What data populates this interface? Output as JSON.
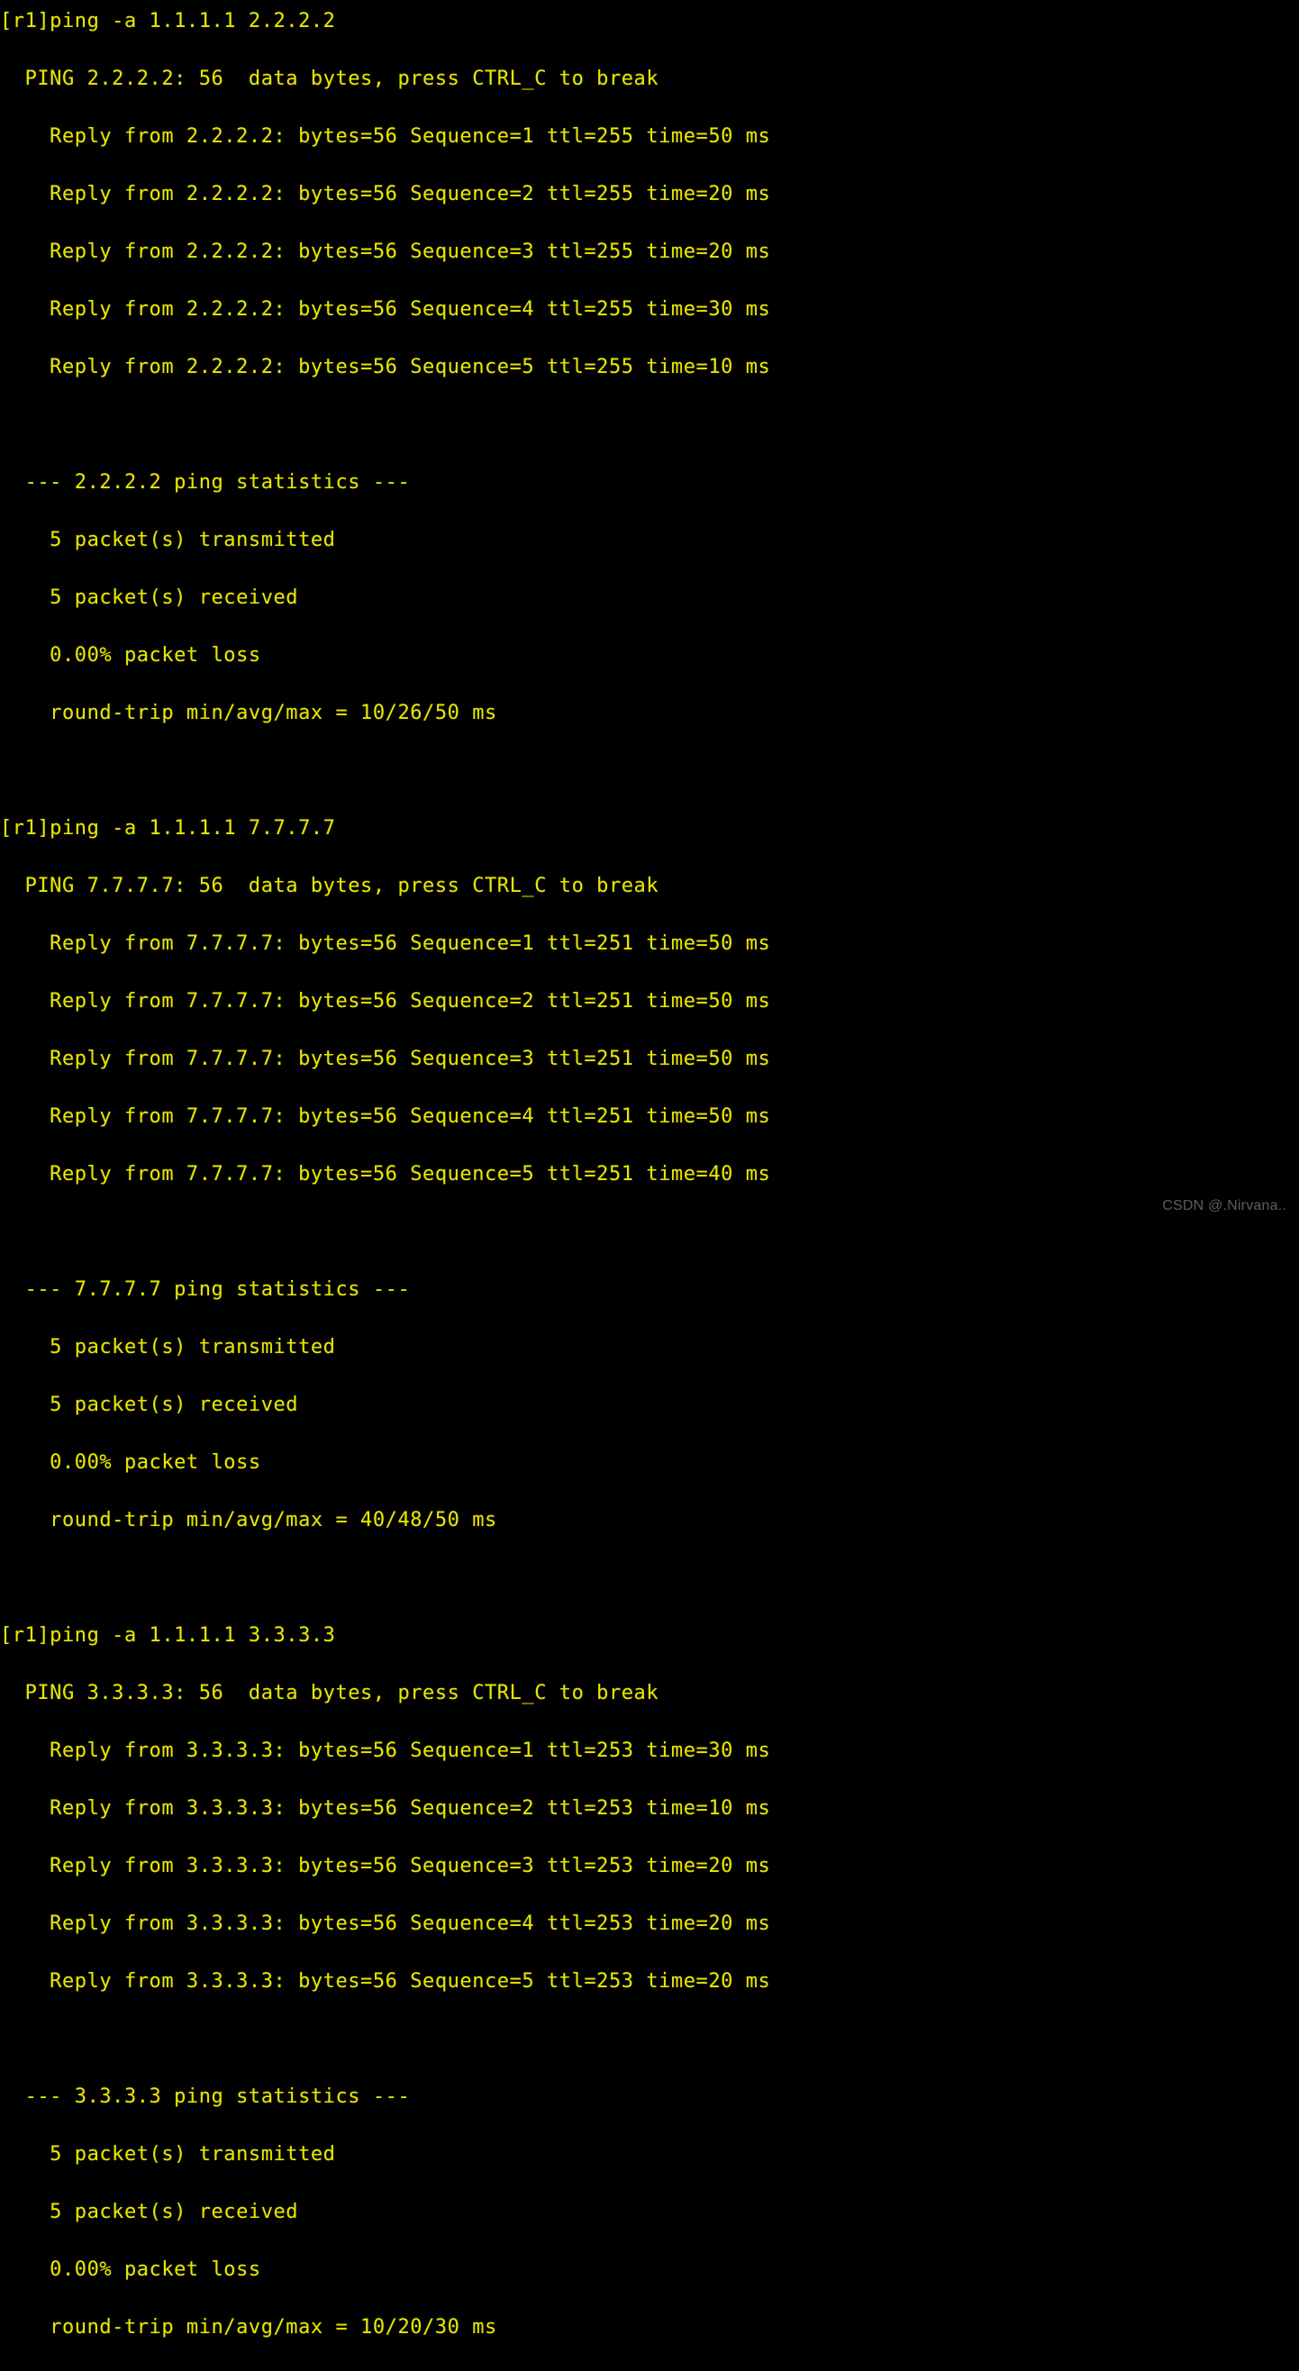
{
  "terminal": {
    "background_color": "#000000",
    "text_color": "#e6e600",
    "watermark": "CSDN @.Nirvana..",
    "watermark_color": "#6e6e6e",
    "prompt": "[r1]",
    "lines": [
      "[r1]ping -a 1.1.1.1 2.2.2.2",
      "  PING 2.2.2.2: 56  data bytes, press CTRL_C to break",
      "    Reply from 2.2.2.2: bytes=56 Sequence=1 ttl=255 time=50 ms",
      "    Reply from 2.2.2.2: bytes=56 Sequence=2 ttl=255 time=20 ms",
      "    Reply from 2.2.2.2: bytes=56 Sequence=3 ttl=255 time=20 ms",
      "    Reply from 2.2.2.2: bytes=56 Sequence=4 ttl=255 time=30 ms",
      "    Reply from 2.2.2.2: bytes=56 Sequence=5 ttl=255 time=10 ms",
      "",
      "  --- 2.2.2.2 ping statistics ---",
      "    5 packet(s) transmitted",
      "    5 packet(s) received",
      "    0.00% packet loss",
      "    round-trip min/avg/max = 10/26/50 ms",
      "",
      "[r1]ping -a 1.1.1.1 7.7.7.7",
      "  PING 7.7.7.7: 56  data bytes, press CTRL_C to break",
      "    Reply from 7.7.7.7: bytes=56 Sequence=1 ttl=251 time=50 ms",
      "    Reply from 7.7.7.7: bytes=56 Sequence=2 ttl=251 time=50 ms",
      "    Reply from 7.7.7.7: bytes=56 Sequence=3 ttl=251 time=50 ms",
      "    Reply from 7.7.7.7: bytes=56 Sequence=4 ttl=251 time=50 ms",
      "    Reply from 7.7.7.7: bytes=56 Sequence=5 ttl=251 time=40 ms",
      "",
      "  --- 7.7.7.7 ping statistics ---",
      "    5 packet(s) transmitted",
      "    5 packet(s) received",
      "    0.00% packet loss",
      "    round-trip min/avg/max = 40/48/50 ms",
      "",
      "[r1]ping -a 1.1.1.1 3.3.3.3",
      "  PING 3.3.3.3: 56  data bytes, press CTRL_C to break",
      "    Reply from 3.3.3.3: bytes=56 Sequence=1 ttl=253 time=30 ms",
      "    Reply from 3.3.3.3: bytes=56 Sequence=2 ttl=253 time=10 ms",
      "    Reply from 3.3.3.3: bytes=56 Sequence=3 ttl=253 time=20 ms",
      "    Reply from 3.3.3.3: bytes=56 Sequence=4 ttl=253 time=20 ms",
      "    Reply from 3.3.3.3: bytes=56 Sequence=5 ttl=253 time=20 ms",
      "",
      "  --- 3.3.3.3 ping statistics ---",
      "    5 packet(s) transmitted",
      "    5 packet(s) received",
      "    0.00% packet loss",
      "    round-trip min/avg/max = 10/20/30 ms"
    ],
    "sessions": [
      {
        "command": "ping -a 1.1.1.1 2.2.2.2",
        "source": "1.1.1.1",
        "target": "2.2.2.2",
        "header": "PING 2.2.2.2: 56  data bytes, press CTRL_C to break",
        "data_bytes": "56",
        "replies": [
          {
            "sequence": "1",
            "bytes": "56",
            "ttl": "255",
            "time": "50",
            "unit": "ms"
          },
          {
            "sequence": "2",
            "bytes": "56",
            "ttl": "255",
            "time": "20",
            "unit": "ms"
          },
          {
            "sequence": "3",
            "bytes": "56",
            "ttl": "255",
            "time": "20",
            "unit": "ms"
          },
          {
            "sequence": "4",
            "bytes": "56",
            "ttl": "255",
            "time": "30",
            "unit": "ms"
          },
          {
            "sequence": "5",
            "bytes": "56",
            "ttl": "255",
            "time": "10",
            "unit": "ms"
          }
        ],
        "statistics": {
          "title": "--- 2.2.2.2 ping statistics ---",
          "transmitted": "5 packet(s) transmitted",
          "received": "5 packet(s) received",
          "loss": "0.00% packet loss",
          "round_trip": "round-trip min/avg/max = 10/26/50 ms",
          "min": "10",
          "avg": "26",
          "max": "50"
        }
      },
      {
        "command": "ping -a 1.1.1.1 7.7.7.7",
        "source": "1.1.1.1",
        "target": "7.7.7.7",
        "header": "PING 7.7.7.7: 56  data bytes, press CTRL_C to break",
        "data_bytes": "56",
        "replies": [
          {
            "sequence": "1",
            "bytes": "56",
            "ttl": "251",
            "time": "50",
            "unit": "ms"
          },
          {
            "sequence": "2",
            "bytes": "56",
            "ttl": "251",
            "time": "50",
            "unit": "ms"
          },
          {
            "sequence": "3",
            "bytes": "56",
            "ttl": "251",
            "time": "50",
            "unit": "ms"
          },
          {
            "sequence": "4",
            "bytes": "56",
            "ttl": "251",
            "time": "50",
            "unit": "ms"
          },
          {
            "sequence": "5",
            "bytes": "56",
            "ttl": "251",
            "time": "40",
            "unit": "ms"
          }
        ],
        "statistics": {
          "title": "--- 7.7.7.7 ping statistics ---",
          "transmitted": "5 packet(s) transmitted",
          "received": "5 packet(s) received",
          "loss": "0.00% packet loss",
          "round_trip": "round-trip min/avg/max = 40/48/50 ms",
          "min": "40",
          "avg": "48",
          "max": "50"
        }
      },
      {
        "command": "ping -a 1.1.1.1 3.3.3.3",
        "source": "1.1.1.1",
        "target": "3.3.3.3",
        "header": "PING 3.3.3.3: 56  data bytes, press CTRL_C to break",
        "data_bytes": "56",
        "replies": [
          {
            "sequence": "1",
            "bytes": "56",
            "ttl": "253",
            "time": "30",
            "unit": "ms"
          },
          {
            "sequence": "2",
            "bytes": "56",
            "ttl": "253",
            "time": "10",
            "unit": "ms"
          },
          {
            "sequence": "3",
            "bytes": "56",
            "ttl": "253",
            "time": "20",
            "unit": "ms"
          },
          {
            "sequence": "4",
            "bytes": "56",
            "ttl": "253",
            "time": "20",
            "unit": "ms"
          },
          {
            "sequence": "5",
            "bytes": "56",
            "ttl": "253",
            "time": "20",
            "unit": "ms"
          }
        ],
        "statistics": {
          "title": "--- 3.3.3.3 ping statistics ---",
          "transmitted": "5 packet(s) transmitted",
          "received": "5 packet(s) received",
          "loss": "0.00% packet loss",
          "round_trip": "round-trip min/avg/max = 10/20/30 ms",
          "min": "10",
          "avg": "20",
          "max": "30"
        }
      }
    ]
  }
}
